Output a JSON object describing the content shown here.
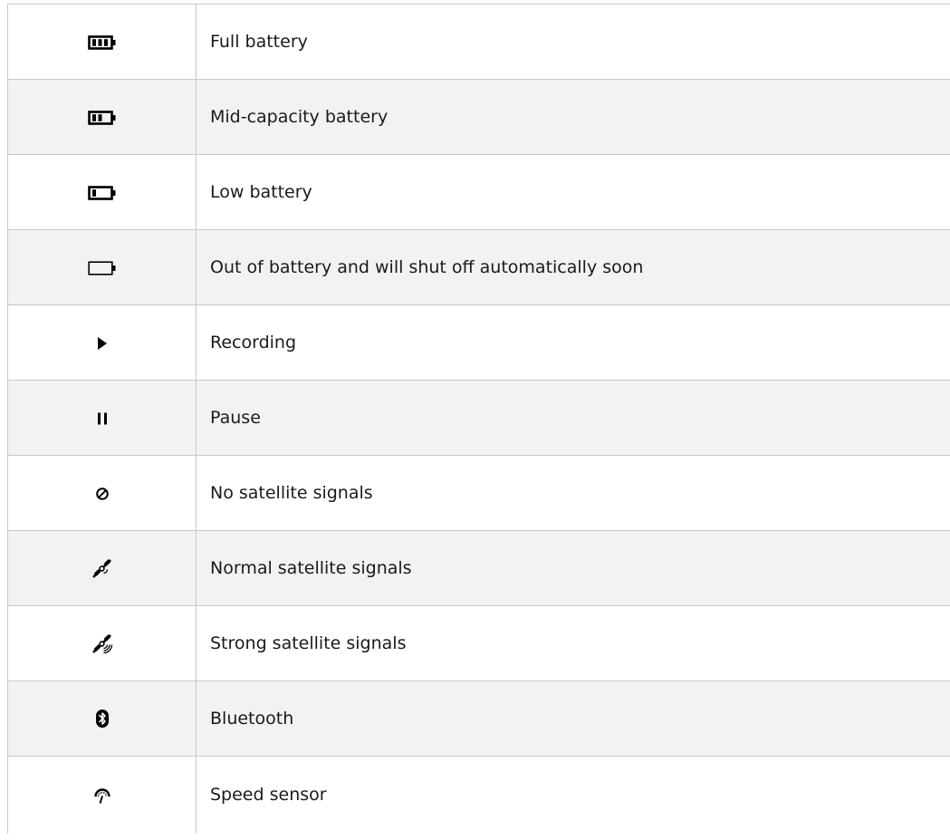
{
  "rows": [
    {
      "icon": "full-battery-icon",
      "label": "Full battery"
    },
    {
      "icon": "mid-battery-icon",
      "label": "Mid-capacity battery"
    },
    {
      "icon": "low-battery-icon",
      "label": "Low battery"
    },
    {
      "icon": "empty-battery-icon",
      "label": "Out of battery and will shut off automatically soon"
    },
    {
      "icon": "play-icon",
      "label": "Recording"
    },
    {
      "icon": "pause-icon",
      "label": "Pause"
    },
    {
      "icon": "no-signal-icon",
      "label": "No satellite signals"
    },
    {
      "icon": "satellite-normal-icon",
      "label": "Normal satellite signals"
    },
    {
      "icon": "satellite-strong-icon",
      "label": "Strong satellite signals"
    },
    {
      "icon": "bluetooth-icon",
      "label": "Bluetooth"
    },
    {
      "icon": "speed-sensor-icon",
      "label": "Speed sensor"
    }
  ]
}
